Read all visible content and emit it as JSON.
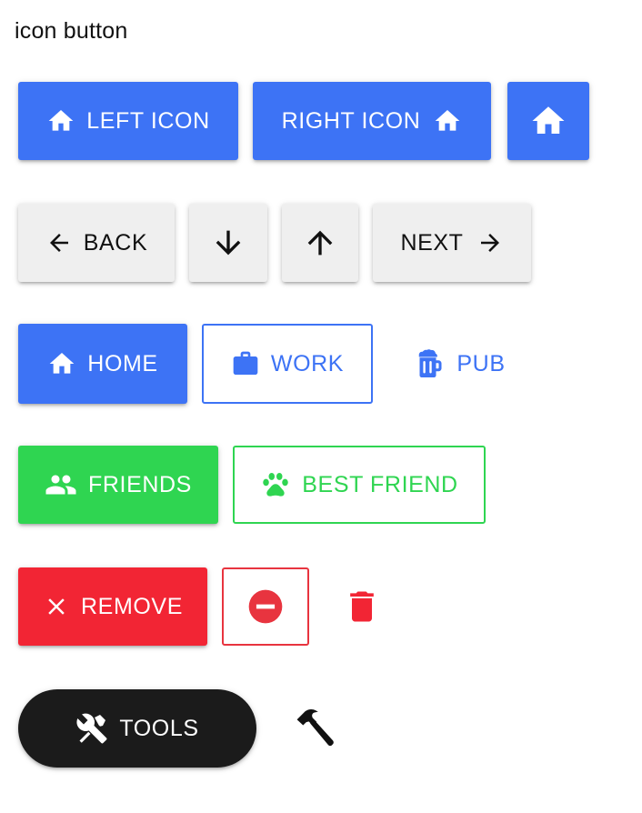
{
  "heading": "icon button",
  "row1": {
    "left_icon_label": "LEFT ICON",
    "right_icon_label": "RIGHT ICON",
    "icon": "home-icon"
  },
  "row2": {
    "back_label": "BACK",
    "next_label": "NEXT",
    "down_icon": "arrow-down-icon",
    "up_icon": "arrow-up-icon"
  },
  "row3": {
    "home_label": "HOME",
    "work_label": "WORK",
    "pub_label": "PUB"
  },
  "row4": {
    "friends_label": "FRIENDS",
    "best_friend_label": "BEST FRIEND"
  },
  "row5": {
    "remove_label": "REMOVE",
    "minus_icon": "minus-circle-icon",
    "trash_icon": "trash-icon"
  },
  "row6": {
    "tools_label": "TOOLS",
    "hammer_icon": "hammer-icon"
  },
  "colors": {
    "blue": "#3d73f5",
    "grey": "#efefef",
    "green": "#2fd551",
    "red": "#f22534",
    "dark": "#1b1b1b"
  }
}
